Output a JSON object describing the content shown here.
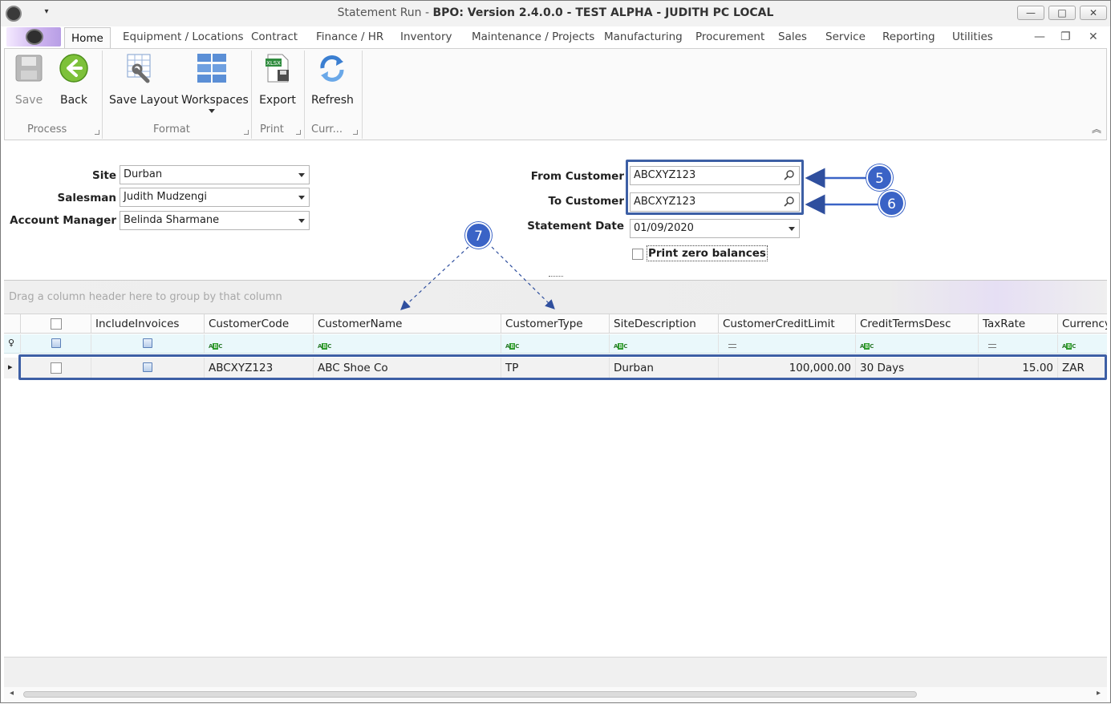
{
  "window": {
    "title_prefix": "Statement Run - ",
    "title_main": "BPO: Version 2.4.0.0 - TEST ALPHA - JUDITH PC LOCAL",
    "minimize_glyph": "—",
    "maximize_glyph": "□",
    "close_glyph": "✕",
    "qat_glyph": "▾"
  },
  "tabs": {
    "home": "Home",
    "equipment": "Equipment / Locations",
    "contract": "Contract",
    "finance": "Finance / HR",
    "inventory": "Inventory",
    "maintenance": "Maintenance / Projects",
    "manufacturing": "Manufacturing",
    "procurement": "Procurement",
    "sales": "Sales",
    "service": "Service",
    "reporting": "Reporting",
    "utilities": "Utilities",
    "mdi_min": "—",
    "mdi_restore": "❐",
    "mdi_close": "✕"
  },
  "ribbon": {
    "save": "Save",
    "back": "Back",
    "save_layout": "Save Layout",
    "workspaces": "Workspaces",
    "export": "Export",
    "refresh": "Refresh",
    "group_process": "Process",
    "group_format": "Format",
    "group_print": "Print",
    "group_curr": "Curr...",
    "collapse_glyph": "︽",
    "xlsx_tag": "XLSX"
  },
  "form": {
    "site_label": "Site",
    "site_value": "Durban",
    "salesman_label": "Salesman",
    "salesman_value": "Judith Mudzengi",
    "account_manager_label": "Account Manager",
    "account_manager_value": "Belinda Sharmane",
    "from_customer_label": "From Customer",
    "from_customer_value": "ABCXYZ123",
    "to_customer_label": "To Customer",
    "to_customer_value": "ABCXYZ123",
    "statement_date_label": "Statement Date",
    "statement_date_value": "01/09/2020",
    "print_zero_label": "Print zero balances"
  },
  "annotations": {
    "badge5": "5",
    "badge6": "6",
    "badge7": "7"
  },
  "grid": {
    "group_panel_text": "Drag a column header here to group by that column",
    "columns": [
      "IncludeInvoices",
      "CustomerCode",
      "CustomerName",
      "CustomerType",
      "SiteDescription",
      "CustomerCreditLimit",
      "CreditTermsDesc",
      "TaxRate",
      "Currency"
    ],
    "filter_abc": [
      "A",
      "B",
      "C"
    ],
    "rows": [
      {
        "customer_code": "ABCXYZ123",
        "customer_name": "ABC Shoe Co",
        "customer_type": "TP",
        "site_description": "Durban",
        "credit_limit": "100,000.00",
        "credit_terms": "30 Days",
        "tax_rate": "15.00",
        "currency": "ZAR"
      }
    ],
    "row_indicator": "▸",
    "filter_indicator": "♀"
  },
  "colors": {
    "accent_blue": "#3a63c6",
    "highlight_border": "#3d5fa5",
    "filter_row_bg": "#eaf8fb"
  },
  "icons": [
    "save-icon",
    "back-arrow-icon",
    "save-layout-icon",
    "workspaces-icon",
    "export-xlsx-icon",
    "refresh-icon",
    "magnifier-icon",
    "dropdown-arrow-icon"
  ]
}
